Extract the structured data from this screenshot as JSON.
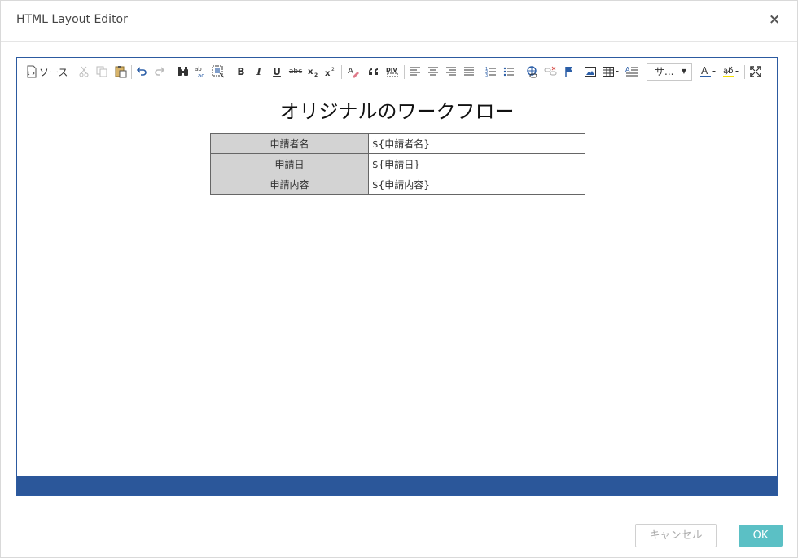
{
  "dialog": {
    "title": "HTML Layout Editor",
    "close_icon": "×"
  },
  "toolbar": {
    "source_label": "ソース",
    "styles_combo": "サ..."
  },
  "document": {
    "title": "オリジナルのワークフロー",
    "rows": [
      {
        "label": "申請者名",
        "value": "${申請者名}"
      },
      {
        "label": "申請日",
        "value": "${申請日}"
      },
      {
        "label": "申請内容",
        "value": "${申請内容}"
      }
    ]
  },
  "footer": {
    "cancel_label": "キャンセル",
    "ok_label": "OK"
  },
  "colors": {
    "editor_border": "#2c5aa0",
    "statusbar": "#2b579a",
    "ok_button": "#5bc0c5",
    "table_label_bg": "#d3d3d3"
  }
}
